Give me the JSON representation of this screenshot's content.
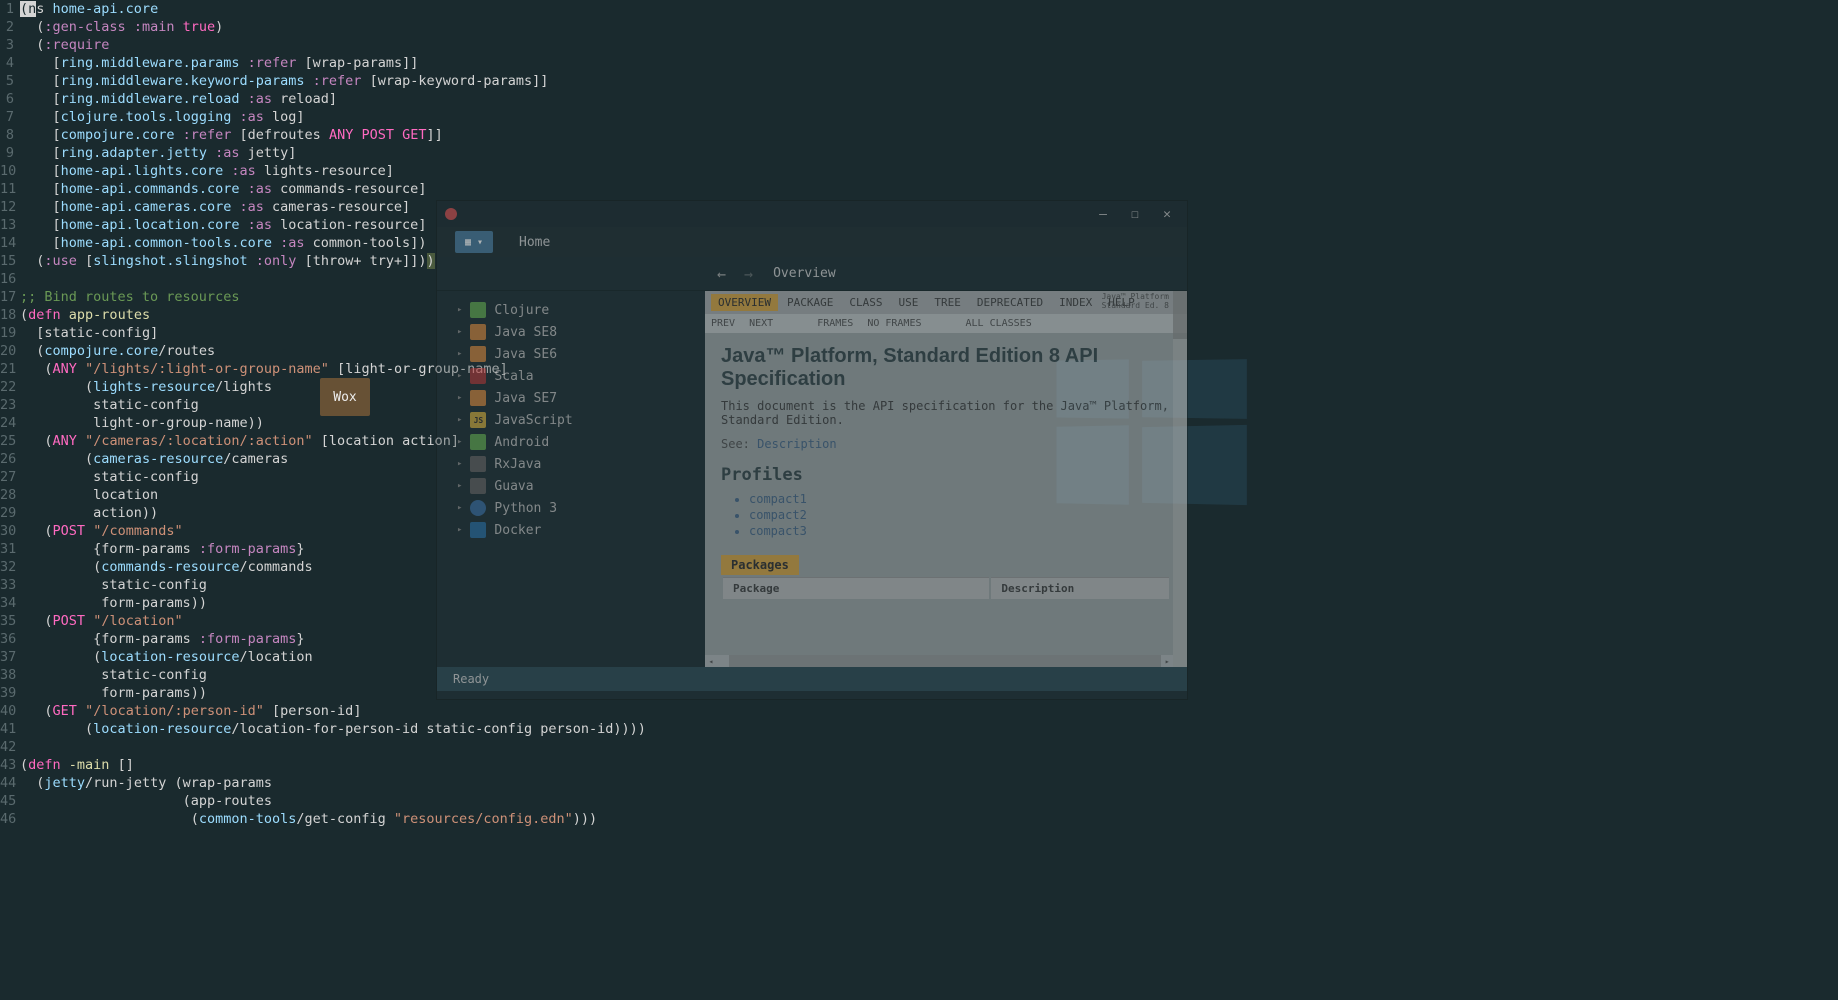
{
  "editor": {
    "lines": [
      {
        "n": 1,
        "tokens": [
          [
            "cursor",
            "(n"
          ],
          [
            "text",
            "s "
          ],
          [
            "sym",
            "home-api.core"
          ]
        ]
      },
      {
        "n": 2,
        "tokens": [
          [
            "text",
            "  "
          ],
          [
            "br",
            "("
          ],
          [
            "keyword",
            ":gen-class"
          ],
          [
            "text",
            " "
          ],
          [
            "keyword",
            ":main"
          ],
          [
            "text",
            " "
          ],
          [
            "pink",
            "true"
          ],
          [
            "br",
            ")"
          ]
        ]
      },
      {
        "n": 3,
        "tokens": [
          [
            "text",
            "  "
          ],
          [
            "br",
            "("
          ],
          [
            "keyword",
            ":require"
          ]
        ]
      },
      {
        "n": 4,
        "tokens": [
          [
            "text",
            "    "
          ],
          [
            "br",
            "["
          ],
          [
            "sym",
            "ring.middleware.params"
          ],
          [
            "text",
            " "
          ],
          [
            "keyword",
            ":refer"
          ],
          [
            "text",
            " "
          ],
          [
            "br",
            "["
          ],
          [
            "text",
            "wrap-params"
          ],
          [
            "br",
            "]]"
          ]
        ]
      },
      {
        "n": 5,
        "tokens": [
          [
            "text",
            "    "
          ],
          [
            "br",
            "["
          ],
          [
            "sym",
            "ring.middleware.keyword-params"
          ],
          [
            "text",
            " "
          ],
          [
            "keyword",
            ":refer"
          ],
          [
            "text",
            " "
          ],
          [
            "br",
            "["
          ],
          [
            "text",
            "wrap-keyword-params"
          ],
          [
            "br",
            "]]"
          ]
        ]
      },
      {
        "n": 6,
        "tokens": [
          [
            "text",
            "    "
          ],
          [
            "br",
            "["
          ],
          [
            "sym",
            "ring.middleware.reload"
          ],
          [
            "text",
            " "
          ],
          [
            "keyword",
            ":as"
          ],
          [
            "text",
            " reload"
          ],
          [
            "br",
            "]"
          ]
        ]
      },
      {
        "n": 7,
        "tokens": [
          [
            "text",
            "    "
          ],
          [
            "br",
            "["
          ],
          [
            "sym",
            "clojure.tools.logging"
          ],
          [
            "text",
            " "
          ],
          [
            "keyword",
            ":as"
          ],
          [
            "text",
            " log"
          ],
          [
            "br",
            "]"
          ]
        ]
      },
      {
        "n": 8,
        "tokens": [
          [
            "text",
            "    "
          ],
          [
            "br",
            "["
          ],
          [
            "sym",
            "compojure.core"
          ],
          [
            "text",
            " "
          ],
          [
            "keyword",
            ":refer"
          ],
          [
            "text",
            " "
          ],
          [
            "br",
            "["
          ],
          [
            "text",
            "defroutes "
          ],
          [
            "pink",
            "ANY POST GET"
          ],
          [
            "br",
            "]]"
          ]
        ]
      },
      {
        "n": 9,
        "tokens": [
          [
            "text",
            "    "
          ],
          [
            "br",
            "["
          ],
          [
            "sym",
            "ring.adapter.jetty"
          ],
          [
            "text",
            " "
          ],
          [
            "keyword",
            ":as"
          ],
          [
            "text",
            " jetty"
          ],
          [
            "br",
            "]"
          ]
        ]
      },
      {
        "n": 10,
        "tokens": [
          [
            "text",
            "    "
          ],
          [
            "br",
            "["
          ],
          [
            "sym",
            "home-api.lights.core"
          ],
          [
            "text",
            " "
          ],
          [
            "keyword",
            ":as"
          ],
          [
            "text",
            " lights-resource"
          ],
          [
            "br",
            "]"
          ]
        ]
      },
      {
        "n": 11,
        "tokens": [
          [
            "text",
            "    "
          ],
          [
            "br",
            "["
          ],
          [
            "sym",
            "home-api.commands.core"
          ],
          [
            "text",
            " "
          ],
          [
            "keyword",
            ":as"
          ],
          [
            "text",
            " commands-resource"
          ],
          [
            "br",
            "]"
          ]
        ]
      },
      {
        "n": 12,
        "tokens": [
          [
            "text",
            "    "
          ],
          [
            "br",
            "["
          ],
          [
            "sym",
            "home-api.cameras.core"
          ],
          [
            "text",
            " "
          ],
          [
            "keyword",
            ":as"
          ],
          [
            "text",
            " cameras-resource"
          ],
          [
            "br",
            "]"
          ]
        ]
      },
      {
        "n": 13,
        "tokens": [
          [
            "text",
            "    "
          ],
          [
            "br",
            "["
          ],
          [
            "sym",
            "home-api.location.core"
          ],
          [
            "text",
            " "
          ],
          [
            "keyword",
            ":as"
          ],
          [
            "text",
            " location-resource"
          ],
          [
            "br",
            "]"
          ]
        ]
      },
      {
        "n": 14,
        "tokens": [
          [
            "text",
            "    "
          ],
          [
            "br",
            "["
          ],
          [
            "sym",
            "home-api.common-tools.core"
          ],
          [
            "text",
            " "
          ],
          [
            "keyword",
            ":as"
          ],
          [
            "text",
            " common-tools"
          ],
          [
            "br",
            "])"
          ]
        ]
      },
      {
        "n": 15,
        "tokens": [
          [
            "text",
            "  "
          ],
          [
            "br",
            "("
          ],
          [
            "keyword",
            ":use"
          ],
          [
            "text",
            " "
          ],
          [
            "br",
            "["
          ],
          [
            "sym",
            "slingshot.slingshot"
          ],
          [
            "text",
            " "
          ],
          [
            "keyword",
            ":only"
          ],
          [
            "text",
            " "
          ],
          [
            "br",
            "["
          ],
          [
            "text",
            "throw+ try+"
          ],
          [
            "br",
            "]])"
          ],
          [
            "highlight",
            ")"
          ]
        ]
      },
      {
        "n": 16,
        "tokens": [
          [
            "text",
            ""
          ]
        ]
      },
      {
        "n": 17,
        "tokens": [
          [
            "comment",
            ";; Bind routes to resources"
          ]
        ]
      },
      {
        "n": 18,
        "tokens": [
          [
            "br",
            "("
          ],
          [
            "pink",
            "defn"
          ],
          [
            "text",
            " "
          ],
          [
            "yellow",
            "app-routes"
          ]
        ]
      },
      {
        "n": 19,
        "tokens": [
          [
            "text",
            "  "
          ],
          [
            "br",
            "["
          ],
          [
            "text",
            "static-config"
          ],
          [
            "br",
            "]"
          ]
        ]
      },
      {
        "n": 20,
        "tokens": [
          [
            "text",
            "  "
          ],
          [
            "br",
            "("
          ],
          [
            "sym",
            "compojure.core"
          ],
          [
            "text",
            "/routes"
          ]
        ]
      },
      {
        "n": 21,
        "tokens": [
          [
            "text",
            "   "
          ],
          [
            "br",
            "("
          ],
          [
            "pink",
            "ANY"
          ],
          [
            "text",
            " "
          ],
          [
            "str",
            "\"/lights/:light-or-group-name\""
          ],
          [
            "text",
            " "
          ],
          [
            "br",
            "["
          ],
          [
            "text",
            "light-or-group-name"
          ],
          [
            "br",
            "]"
          ]
        ]
      },
      {
        "n": 22,
        "tokens": [
          [
            "text",
            "        "
          ],
          [
            "br",
            "("
          ],
          [
            "sym",
            "lights-resource"
          ],
          [
            "text",
            "/lights"
          ]
        ]
      },
      {
        "n": 23,
        "tokens": [
          [
            "text",
            "         static-config"
          ]
        ]
      },
      {
        "n": 24,
        "tokens": [
          [
            "text",
            "         light-or-group-name"
          ],
          [
            "br",
            "))"
          ]
        ]
      },
      {
        "n": 25,
        "tokens": [
          [
            "text",
            "   "
          ],
          [
            "br",
            "("
          ],
          [
            "pink",
            "ANY"
          ],
          [
            "text",
            " "
          ],
          [
            "str",
            "\"/cameras/:location/:action\""
          ],
          [
            "text",
            " "
          ],
          [
            "br",
            "["
          ],
          [
            "text",
            "location action"
          ],
          [
            "br",
            "]"
          ]
        ]
      },
      {
        "n": 26,
        "tokens": [
          [
            "text",
            "        "
          ],
          [
            "br",
            "("
          ],
          [
            "sym",
            "cameras-resource"
          ],
          [
            "text",
            "/cameras"
          ]
        ]
      },
      {
        "n": 27,
        "tokens": [
          [
            "text",
            "         static-config"
          ]
        ]
      },
      {
        "n": 28,
        "tokens": [
          [
            "text",
            "         location"
          ]
        ]
      },
      {
        "n": 29,
        "tokens": [
          [
            "text",
            "         action"
          ],
          [
            "br",
            "))"
          ]
        ]
      },
      {
        "n": 30,
        "tokens": [
          [
            "text",
            "   "
          ],
          [
            "br",
            "("
          ],
          [
            "pink",
            "POST"
          ],
          [
            "text",
            " "
          ],
          [
            "str",
            "\"/commands\""
          ]
        ]
      },
      {
        "n": 31,
        "tokens": [
          [
            "text",
            "         "
          ],
          [
            "br",
            "{"
          ],
          [
            "text",
            "form-params "
          ],
          [
            "keyword",
            ":form-params"
          ],
          [
            "br",
            "}"
          ]
        ]
      },
      {
        "n": 32,
        "tokens": [
          [
            "text",
            "         "
          ],
          [
            "br",
            "("
          ],
          [
            "sym",
            "commands-resource"
          ],
          [
            "text",
            "/commands"
          ]
        ]
      },
      {
        "n": 33,
        "tokens": [
          [
            "text",
            "          static-config"
          ]
        ]
      },
      {
        "n": 34,
        "tokens": [
          [
            "text",
            "          form-params"
          ],
          [
            "br",
            "))"
          ]
        ]
      },
      {
        "n": 35,
        "tokens": [
          [
            "text",
            "   "
          ],
          [
            "br",
            "("
          ],
          [
            "pink",
            "POST"
          ],
          [
            "text",
            " "
          ],
          [
            "str",
            "\"/location\""
          ]
        ]
      },
      {
        "n": 36,
        "tokens": [
          [
            "text",
            "         "
          ],
          [
            "br",
            "{"
          ],
          [
            "text",
            "form-params "
          ],
          [
            "keyword",
            ":form-params"
          ],
          [
            "br",
            "}"
          ]
        ]
      },
      {
        "n": 37,
        "tokens": [
          [
            "text",
            "         "
          ],
          [
            "br",
            "("
          ],
          [
            "sym",
            "location-resource"
          ],
          [
            "text",
            "/location"
          ]
        ]
      },
      {
        "n": 38,
        "tokens": [
          [
            "text",
            "          static-config"
          ]
        ]
      },
      {
        "n": 39,
        "tokens": [
          [
            "text",
            "          form-params"
          ],
          [
            "br",
            "))"
          ]
        ]
      },
      {
        "n": 40,
        "tokens": [
          [
            "text",
            "   "
          ],
          [
            "br",
            "("
          ],
          [
            "pink",
            "GET"
          ],
          [
            "text",
            " "
          ],
          [
            "str",
            "\"/location/:person-id\""
          ],
          [
            "text",
            " "
          ],
          [
            "br",
            "["
          ],
          [
            "text",
            "person-id"
          ],
          [
            "br",
            "]"
          ]
        ]
      },
      {
        "n": 41,
        "tokens": [
          [
            "text",
            "        "
          ],
          [
            "br",
            "("
          ],
          [
            "sym",
            "location-resource"
          ],
          [
            "text",
            "/location-for-person-id static-config person-id"
          ],
          [
            "br",
            "))))"
          ]
        ]
      },
      {
        "n": 42,
        "tokens": [
          [
            "text",
            ""
          ]
        ]
      },
      {
        "n": 43,
        "tokens": [
          [
            "br",
            "("
          ],
          [
            "pink",
            "defn"
          ],
          [
            "text",
            " "
          ],
          [
            "yellow",
            "-main"
          ],
          [
            "text",
            " "
          ],
          [
            "br",
            "[]"
          ]
        ]
      },
      {
        "n": 44,
        "tokens": [
          [
            "text",
            "  "
          ],
          [
            "br",
            "("
          ],
          [
            "sym",
            "jetty"
          ],
          [
            "text",
            "/run-jetty "
          ],
          [
            "br",
            "("
          ],
          [
            "text",
            "wrap-params"
          ]
        ]
      },
      {
        "n": 45,
        "tokens": [
          [
            "text",
            "                    "
          ],
          [
            "br",
            "("
          ],
          [
            "text",
            "app-routes"
          ]
        ]
      },
      {
        "n": 46,
        "tokens": [
          [
            "text",
            "                     "
          ],
          [
            "br",
            "("
          ],
          [
            "sym",
            "common-tools"
          ],
          [
            "text",
            "/get-config "
          ],
          [
            "str",
            "\"resources/config.edn\""
          ],
          [
            "br",
            ")))"
          ]
        ]
      }
    ]
  },
  "zeal": {
    "tab_home": "Home",
    "flag": "▦ ▾",
    "nav_back": "←",
    "nav_fwd": "→",
    "breadcrumb": "Overview",
    "sidebar": [
      {
        "icon": "icon-clj",
        "label": "Clojure"
      },
      {
        "icon": "icon-java",
        "label": "Java SE8"
      },
      {
        "icon": "icon-java",
        "label": "Java SE6"
      },
      {
        "icon": "icon-scala",
        "label": "Scala"
      },
      {
        "icon": "icon-java",
        "label": "Java SE7"
      },
      {
        "icon": "icon-js",
        "label": "JavaScript",
        "badge": "JS"
      },
      {
        "icon": "icon-and",
        "label": "Android"
      },
      {
        "icon": "icon-rx",
        "label": "RxJava"
      },
      {
        "icon": "icon-gv",
        "label": "Guava"
      },
      {
        "icon": "icon-py",
        "label": "Python 3"
      },
      {
        "icon": "icon-dk",
        "label": "Docker"
      }
    ],
    "nav": {
      "items": [
        "OVERVIEW",
        "PACKAGE",
        "CLASS",
        "USE",
        "TREE",
        "DEPRECATED",
        "INDEX",
        "HELP"
      ],
      "logo1": "Java™  Platform",
      "logo2": "Standard Ed. 8",
      "sub": [
        "PREV",
        "NEXT",
        "",
        "FRAMES",
        "NO FRAMES",
        "",
        "ALL CLASSES"
      ]
    },
    "title": "Java™  Platform, Standard Edition 8 API Specification",
    "desc": "This document is the API specification for the Java™ Platform, Standard Edition.",
    "see_label": "See:",
    "see_link": "Description",
    "profiles_h": "Profiles",
    "profiles": [
      "compact1",
      "compact2",
      "compact3"
    ],
    "packages_h": "Packages",
    "table": {
      "col1": "Package",
      "col2": "Description"
    },
    "status": "Ready",
    "minimize": "—",
    "maximize": "☐",
    "close": "✕"
  },
  "wox": "Wox"
}
